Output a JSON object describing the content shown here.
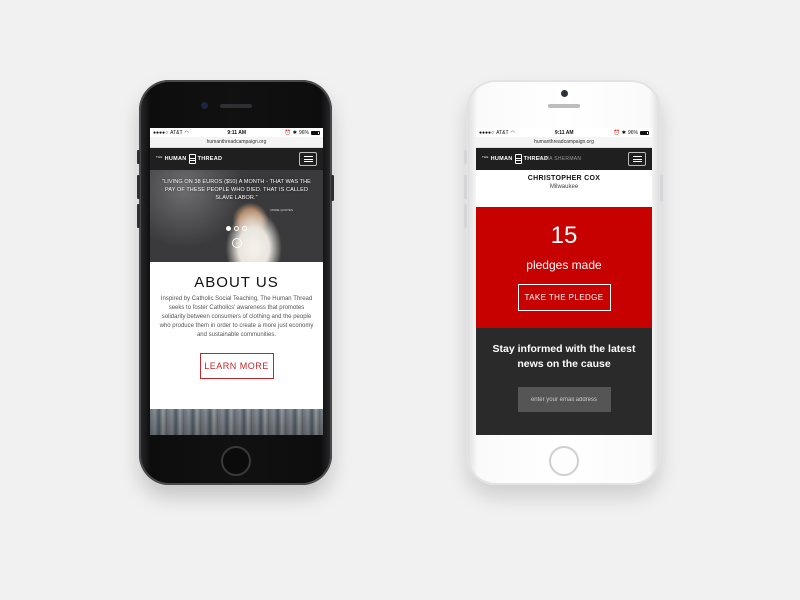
{
  "left_phone": {
    "status": {
      "carrier": "AT&T",
      "time": "9:11 AM",
      "battery": "96%"
    },
    "url": "humanthreadcampaign.org",
    "logo": {
      "small": "THE",
      "word1": "HUMAN",
      "word2": "THREAD"
    },
    "hero": {
      "quote": "\"LIVING ON 38 EUROS ($50) A MONTH - THAT WAS THE PAY OF THESE PEOPLE WHO DIED. THAT IS CALLED SLAVE LABOR.\"",
      "more": "MORE QUOTES",
      "down_arrow": "↓"
    },
    "about": {
      "heading": "ABOUT US",
      "body": "Inspired by Catholic Social Teaching, The Human Thread seeks to foster Catholics' awareness that promotes solidarity between consumers of clothing and the people who produce them in order to create a more just economy and sustainable communities.",
      "button": "LEARN MORE"
    }
  },
  "right_phone": {
    "status": {
      "carrier": "AT&T",
      "time": "9:11 AM",
      "battery": "96%"
    },
    "url": "humanthreadcampaign.org",
    "logo": {
      "small": "THE",
      "word1": "HUMAN",
      "word2": "THREAD"
    },
    "nav_overlap_name": "ALMA SHERMAN",
    "pledger": {
      "name": "CHRISTOPHER COX",
      "city": "Milwaukee"
    },
    "pledges": {
      "count": "15",
      "label": "pledges made",
      "button": "TAKE THE PLEDGE"
    },
    "newsletter": {
      "title": "Stay informed with the latest news on the cause",
      "placeholder": "enter your email address"
    }
  },
  "colors": {
    "accent_red": "#c70000",
    "button_red": "#c1272d",
    "dark": "#1f1f1f"
  },
  "icons": [
    "wifi-icon",
    "battery-icon",
    "menu-icon",
    "thread-spool-icon",
    "down-arrow-icon"
  ]
}
